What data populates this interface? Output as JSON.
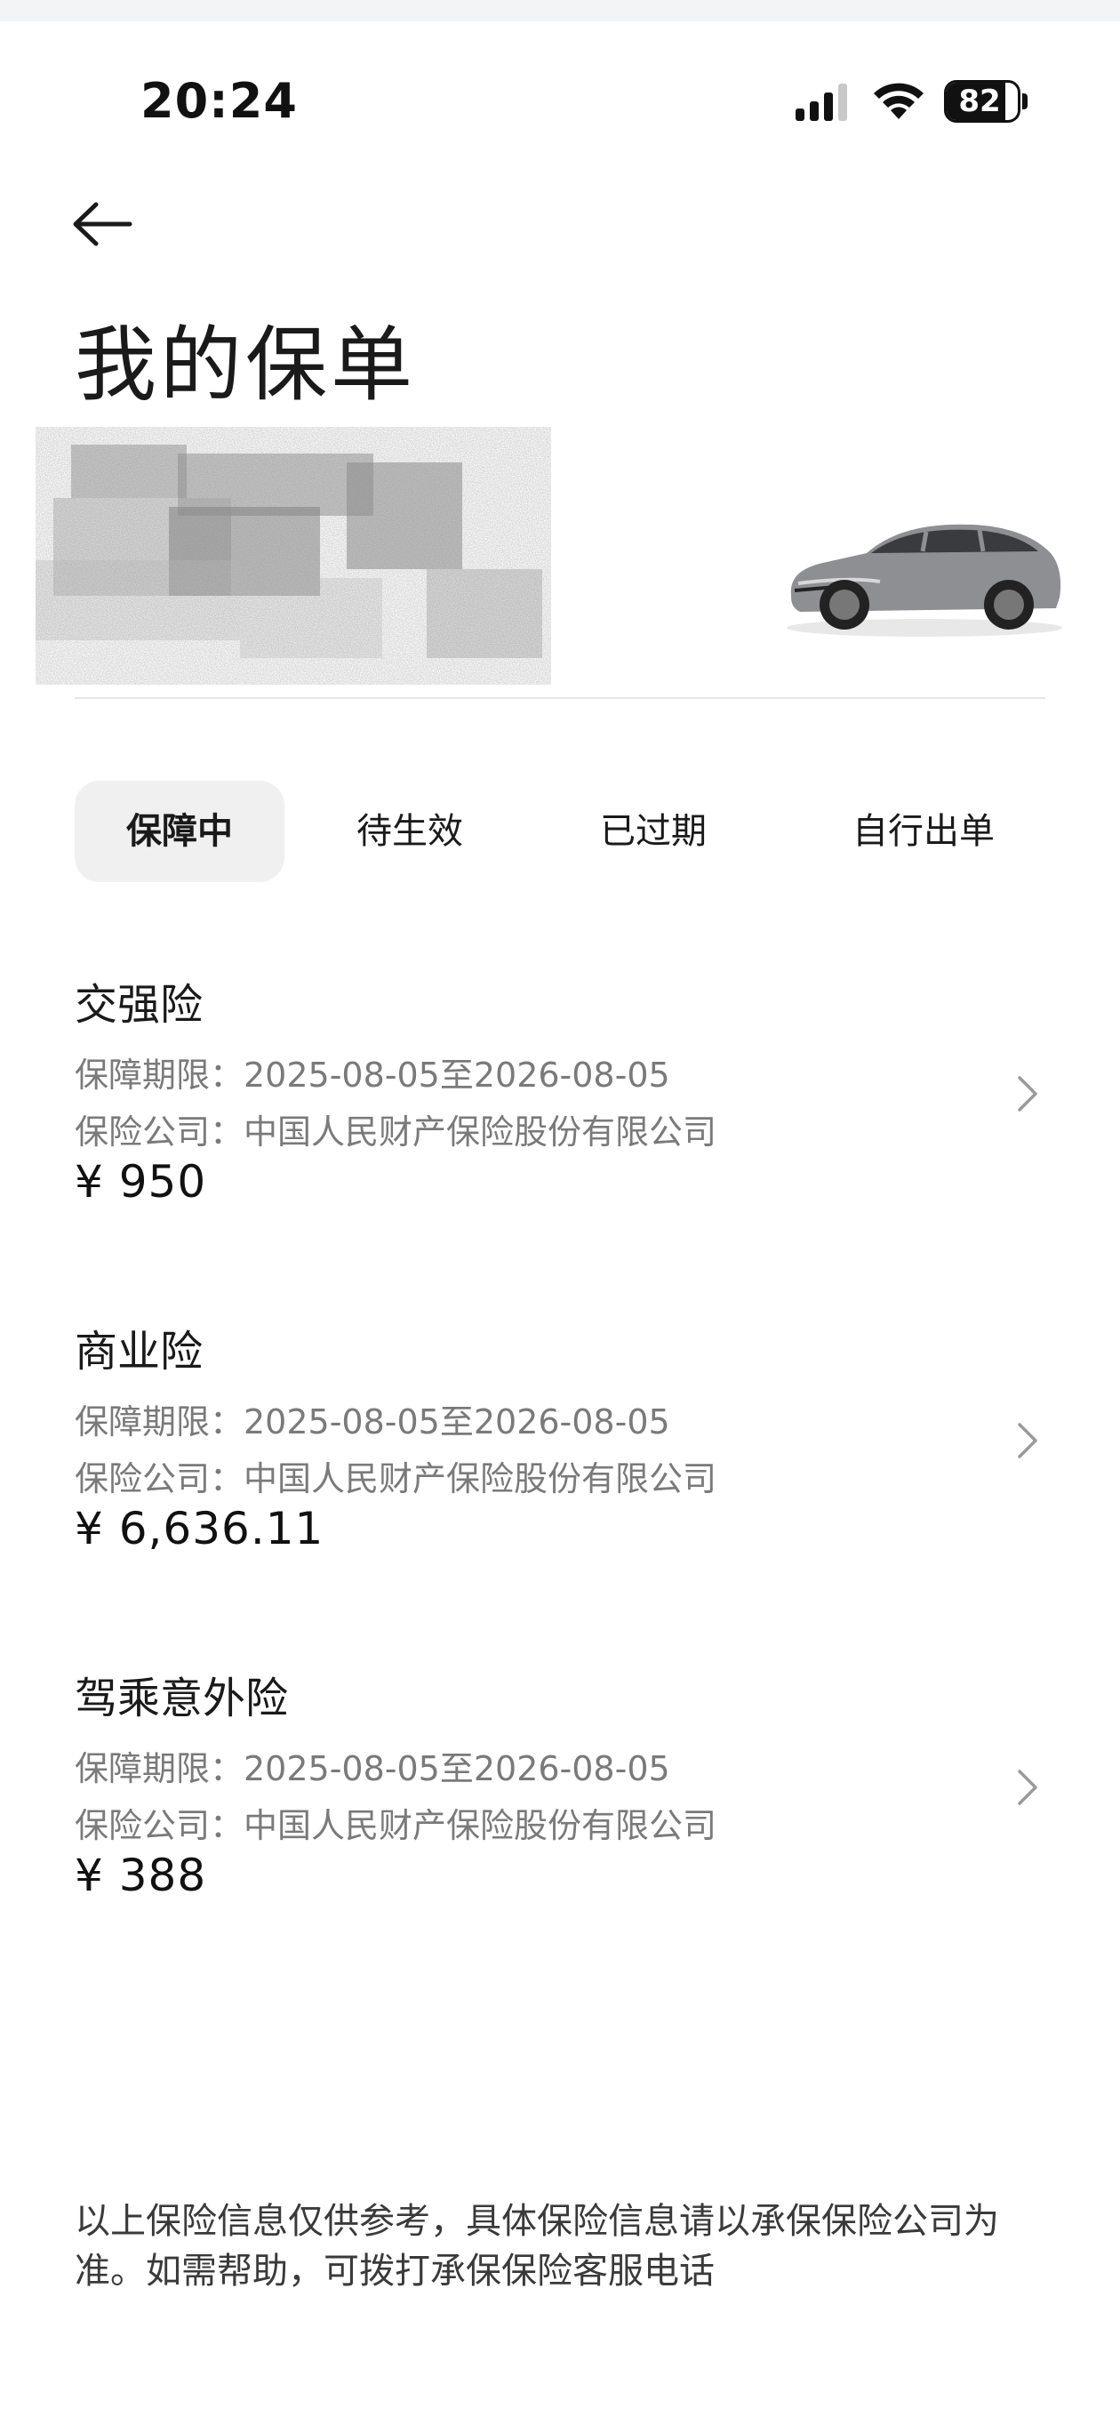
{
  "status_bar": {
    "time": "20:24",
    "battery_level": "82",
    "icons": [
      "signal-icon",
      "wifi-icon",
      "battery-icon"
    ]
  },
  "header": {
    "back_icon": "arrow-left-icon",
    "title": "我的保单"
  },
  "vehicle": {
    "image": "car-image"
  },
  "tabs": [
    {
      "label": "保障中",
      "active": true
    },
    {
      "label": "待生效",
      "active": false
    },
    {
      "label": "已过期",
      "active": false
    },
    {
      "label": "自行出单",
      "active": false
    }
  ],
  "policies": [
    {
      "name": "交强险",
      "period": "保障期限：2025-08-05至2026-08-05",
      "company": "保险公司：中国人民财产保险股份有限公司",
      "price": "¥ 950"
    },
    {
      "name": "商业险",
      "period": "保障期限：2025-08-05至2026-08-05",
      "company": "保险公司：中国人民财产保险股份有限公司",
      "price": "¥ 6,636.11"
    },
    {
      "name": "驾乘意外险",
      "period": "保障期限：2025-08-05至2026-08-05",
      "company": "保险公司：中国人民财产保险股份有限公司",
      "price": "¥ 388"
    }
  ],
  "footer": {
    "note_line1": "以上保险信息仅供参考，具体保险信息请以承保保险公司为",
    "note_line2": "准。如需帮助，可拨打承保保险客服电话"
  },
  "colors": {
    "tab_active_bg": "#f0f0f0",
    "secondary_text": "#7a7a7a",
    "divider": "#e6e6e6"
  }
}
